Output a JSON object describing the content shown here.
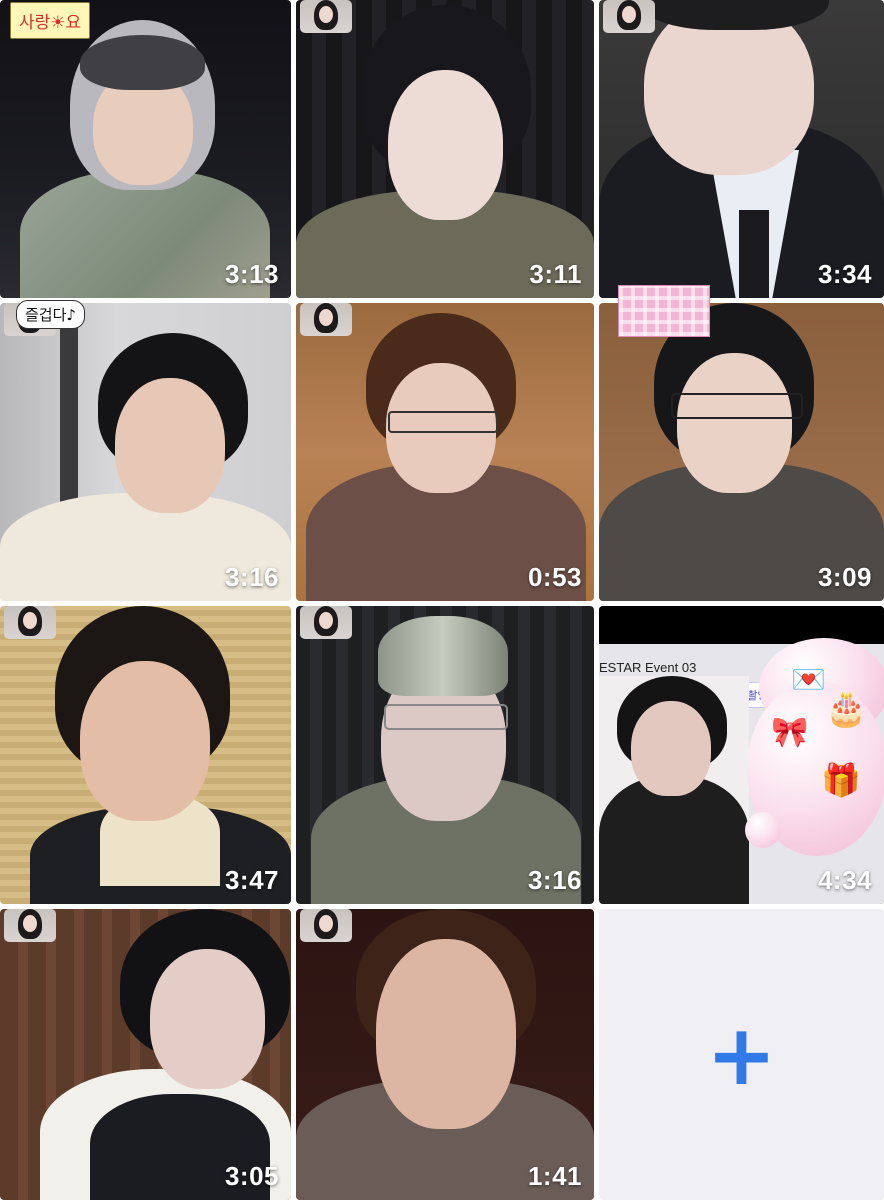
{
  "stickers": {
    "love": "사랑☀요",
    "fun": "즐겁다♪"
  },
  "tiles": [
    {
      "duration": "3:13"
    },
    {
      "duration": "3:11"
    },
    {
      "duration": "3:34"
    },
    {
      "duration": "3:16"
    },
    {
      "duration": "0:53"
    },
    {
      "duration": "3:09"
    },
    {
      "duration": "3:47"
    },
    {
      "duration": "3:16"
    },
    {
      "duration": "4:34"
    },
    {
      "duration": "3:05"
    },
    {
      "duration": "1:41"
    }
  ],
  "tile9": {
    "event_label": "ESTAR Event 03",
    "bubble_text": "공 사진 촬영이 시작"
  },
  "add_button": {
    "icon": "plus-icon",
    "symbol": "+",
    "color": "#2f7ae6"
  }
}
